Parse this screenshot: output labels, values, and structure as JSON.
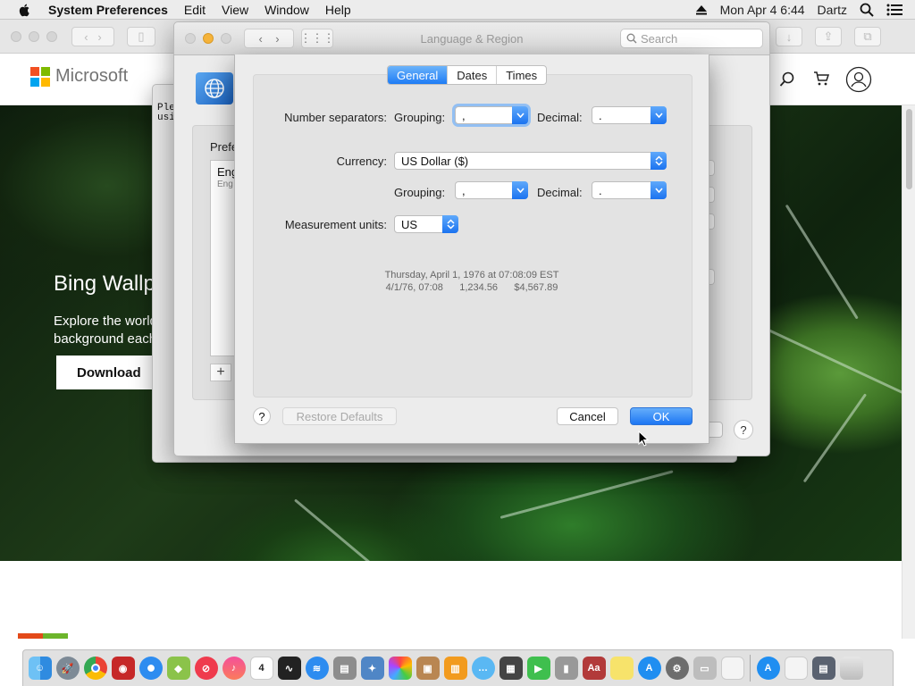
{
  "menubar": {
    "app_name": "System Preferences",
    "items": [
      "Edit",
      "View",
      "Window",
      "Help"
    ],
    "clock": "Mon Apr 4  6:44",
    "user": "Dartz"
  },
  "browser": {
    "brand": "Microsoft",
    "hero_title": "Bing Wallp",
    "hero_body_line1": "Explore the world",
    "hero_body_line2": "background each",
    "hero_button": "Download"
  },
  "back_window": {
    "terminal_line1": "Ple",
    "terminal_line2": "usi"
  },
  "language_window": {
    "title": "Language & Region",
    "search_placeholder": "Search",
    "panel_label": "Prefe",
    "list_item_primary": "Eng",
    "list_item_secondary": "Eng",
    "add_label": "+",
    "help_label": "?"
  },
  "sheet": {
    "tabs": [
      {
        "label": "General",
        "active": true
      },
      {
        "label": "Dates",
        "active": false
      },
      {
        "label": "Times",
        "active": false
      }
    ],
    "number_separators_label": "Number separators:",
    "grouping_label": "Grouping:",
    "decimal_label": "Decimal:",
    "number_grouping_value": ",",
    "number_decimal_value": ".",
    "currency_label": "Currency:",
    "currency_value": "US Dollar ($)",
    "currency_grouping_label": "Grouping:",
    "currency_decimal_label": "Decimal:",
    "currency_grouping_value": ",",
    "currency_decimal_value": ".",
    "measurement_label": "Measurement units:",
    "measurement_value": "US",
    "sample_line1": "Thursday, April 1, 1976 at 07:08:09 EST",
    "sample_line2": "4/1/76, 07:08      1,234.56      $4,567.89",
    "help_label": "?",
    "restore_defaults": "Restore Defaults",
    "cancel": "Cancel",
    "ok": "OK"
  },
  "dock": {
    "items": [
      "finder-icon",
      "launchpad-icon",
      "chrome-icon",
      "photo-booth-icon",
      "safari-icon",
      "maps-icon",
      "news-icon",
      "music-icon",
      "calendar-icon",
      "stocks-icon",
      "wifi-icon",
      "notes-app-icon",
      "preview-icon",
      "photos-icon",
      "contacts-icon",
      "books-icon",
      "messages-icon",
      "photo-icon",
      "facetime-icon",
      "script-icon",
      "dictionary-icon",
      "stickies-icon",
      "app-store-icon",
      "system-preferences-icon",
      "printer-icon",
      "textedit-icon",
      "app-store-icon",
      "file-icon",
      "screenshot-icon",
      "trash-icon"
    ],
    "calendar_day": "4"
  },
  "colors": {
    "accent": "#1e7cf5",
    "menubar": "#ececec"
  }
}
